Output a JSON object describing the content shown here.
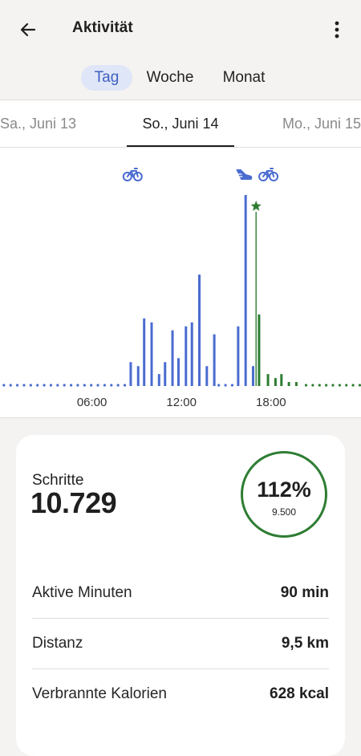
{
  "appbar": {
    "title": "Aktivität",
    "back_icon": "arrow-back-icon",
    "menu_icon": "more-vertical-icon"
  },
  "tabs": [
    {
      "label": "Tag",
      "active": true
    },
    {
      "label": "Woche",
      "active": false
    },
    {
      "label": "Monat",
      "active": false
    }
  ],
  "dates": {
    "prev": "Sa., Juni 13",
    "current": "So., Juni 14",
    "next": "Mo., Juni 15"
  },
  "colors": {
    "accent": "#4a6bd0",
    "goal": "#2e7d32",
    "tab_active_bg": "#dfe6f7"
  },
  "chart_data": {
    "type": "bar",
    "x_ticks": [
      "06:00",
      "12:00",
      "18:00"
    ],
    "x_unit": "hour of day",
    "y_label": "",
    "bars": [
      {
        "hour": 8.6,
        "value": 6
      },
      {
        "hour": 9.1,
        "value": 5
      },
      {
        "hour": 9.5,
        "value": 17
      },
      {
        "hour": 10.0,
        "value": 16
      },
      {
        "hour": 10.5,
        "value": 3
      },
      {
        "hour": 10.9,
        "value": 6
      },
      {
        "hour": 11.4,
        "value": 14
      },
      {
        "hour": 11.8,
        "value": 7
      },
      {
        "hour": 12.3,
        "value": 15
      },
      {
        "hour": 12.7,
        "value": 16
      },
      {
        "hour": 13.2,
        "value": 28
      },
      {
        "hour": 13.7,
        "value": 5
      },
      {
        "hour": 14.2,
        "value": 13
      },
      {
        "hour": 15.8,
        "value": 15
      },
      {
        "hour": 16.3,
        "value": 48
      },
      {
        "hour": 16.8,
        "value": 5
      },
      {
        "hour": 17.2,
        "value": 18,
        "goal_reached": true
      },
      {
        "hour": 17.8,
        "value": 3,
        "goal_reached": true
      },
      {
        "hour": 18.3,
        "value": 2,
        "goal_reached": true
      },
      {
        "hour": 18.7,
        "value": 3,
        "goal_reached": true
      },
      {
        "hour": 19.2,
        "value": 1,
        "goal_reached": true
      },
      {
        "hour": 19.7,
        "value": 1,
        "goal_reached": true
      }
    ],
    "goal_marker_hour": 17.0,
    "activity_icons": [
      {
        "icon": "bike-icon",
        "hour": 8.7
      },
      {
        "icon": "shoe-icon",
        "hour": 16.2
      },
      {
        "icon": "bike-icon",
        "hour": 17.8
      }
    ],
    "grid": false
  },
  "summary": {
    "steps_label": "Schritte",
    "steps_value": "10.729",
    "goal_percent": "112%",
    "goal_value": "9.500",
    "goal_progress": 1.12
  },
  "metrics": [
    {
      "label": "Aktive Minuten",
      "value": "90 min"
    },
    {
      "label": "Distanz",
      "value": "9,5 km"
    },
    {
      "label": "Verbrannte Kalorien",
      "value": "628 kcal"
    }
  ]
}
